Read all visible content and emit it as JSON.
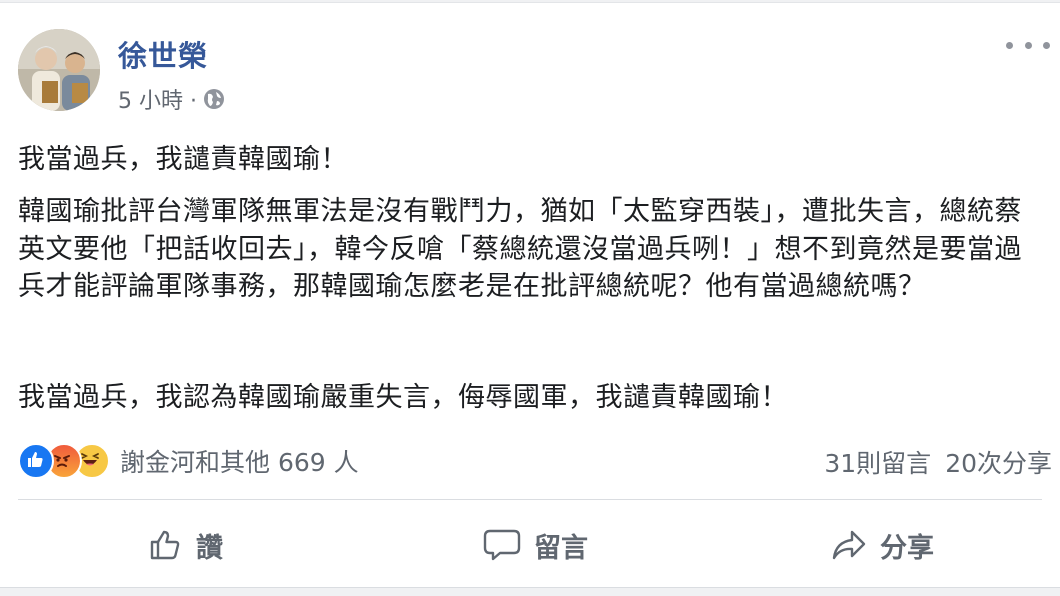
{
  "post": {
    "author": "徐世榮",
    "time": "5 小時 ·",
    "privacy_icon": "globe-icon",
    "more_icon": "more-dots-icon",
    "paragraphs": [
      "我當過兵，我譴責韓國瑜！",
      "韓國瑜批評台灣軍隊無軍法是沒有戰鬥力，猶如「太監穿西裝」，遭批失言，總統蔡英文要他「把話收回去」，韓今反嗆「蔡總統還沒當過兵咧！」想不到竟然是要當過兵才能評論軍隊事務，那韓國瑜怎麼老是在批評總統呢？他有當過總統嗎？",
      "我當過兵，我認為韓國瑜嚴重失言，侮辱國軍，我譴責韓國瑜！"
    ]
  },
  "reactions": {
    "icons": [
      "like-reaction-icon",
      "angry-reaction-icon",
      "haha-reaction-icon"
    ],
    "summary": "謝金河和其他 669 人",
    "comments": "31則留言",
    "shares": "20次分享"
  },
  "actions": {
    "like_label": "讚",
    "comment_label": "留言",
    "share_label": "分享"
  },
  "colors": {
    "author": "#365899",
    "text": "#1c1e21",
    "secondary": "#606770",
    "like": "#1877f2"
  }
}
